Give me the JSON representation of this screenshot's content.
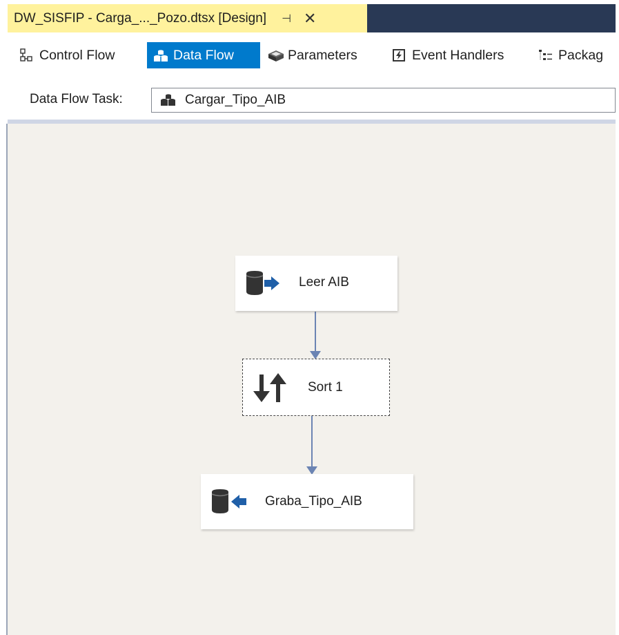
{
  "document_tab": {
    "title": "DW_SISFIP - Carga_..._Pozo.dtsx [Design]",
    "pin_icon": "pin-icon",
    "close_icon": "close-icon"
  },
  "designer_tabs": [
    {
      "label": "Control Flow",
      "icon": "control-flow-icon",
      "active": false
    },
    {
      "label": "Data Flow",
      "icon": "data-flow-icon",
      "active": true
    },
    {
      "label": "Parameters",
      "icon": "parameters-icon",
      "active": false
    },
    {
      "label": "Event Handlers",
      "icon": "event-handlers-icon",
      "active": false
    },
    {
      "label": "Packag",
      "icon": "package-explorer-icon",
      "active": false
    }
  ],
  "task_selector": {
    "label": "Data Flow Task:",
    "value": "Cargar_Tipo_AIB"
  },
  "components": [
    {
      "name": "Leer AIB",
      "icon": "source-icon"
    },
    {
      "name": "Sort 1",
      "icon": "sort-icon"
    },
    {
      "name": "Graba_Tipo_AIB",
      "icon": "destination-icon"
    }
  ],
  "colors": {
    "active_tab": "#007acc",
    "document_tab": "#fff29d",
    "title_bar": "#293955",
    "canvas": "#f3f1ec",
    "connector": "#6b84b3",
    "arrow_blue": "#1f5fa8"
  }
}
